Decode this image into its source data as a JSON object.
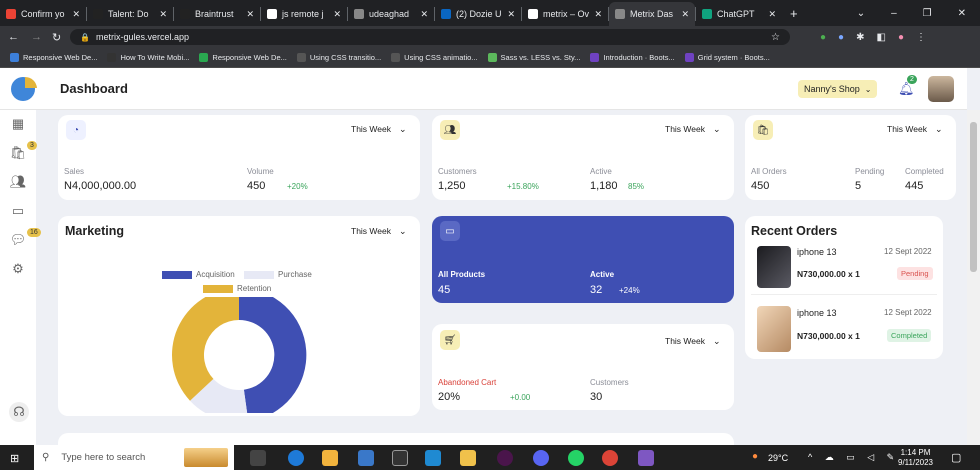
{
  "browser": {
    "tabs": [
      {
        "label": "Confirm yo",
        "color": "#ea4335"
      },
      {
        "label": "Talent: Do",
        "color": "#222"
      },
      {
        "label": "Braintrust",
        "color": "#222"
      },
      {
        "label": "js remote j",
        "color": "#fff"
      },
      {
        "label": "udeaghad",
        "color": "#888"
      },
      {
        "label": "(2) Dozie U",
        "color": "#0a66c2"
      },
      {
        "label": "metrix – Ov",
        "color": "#fff"
      },
      {
        "label": "Metrix Das",
        "color": "#888"
      },
      {
        "label": "ChatGPT",
        "color": "#10a37f"
      }
    ],
    "url": "metrix-gules.vercel.app",
    "bookmarks": [
      "Responsive Web De...",
      "How To Write Mobi...",
      "Responsive Web De...",
      "Using CSS transitio...",
      "Using CSS animatio...",
      "Sass vs. LESS vs. Sty...",
      "Introduction · Boots...",
      "Grid system · Boots..."
    ]
  },
  "header": {
    "title": "Dashboard",
    "shop": "Nanny's Shop",
    "notifications": "2"
  },
  "sidebar": {
    "badges": {
      "orders": "3",
      "messages": "16"
    }
  },
  "sales_card": {
    "period": "This Week",
    "sales_label": "Sales",
    "sales_value": "N4,000,000.00",
    "volume_label": "Volume",
    "volume_value": "450",
    "volume_change": "+20%"
  },
  "customers_card": {
    "period": "This Week",
    "customers_label": "Customers",
    "customers_value": "1,250",
    "customers_change": "+15.80%",
    "active_label": "Active",
    "active_value": "1,180",
    "active_change": "85%"
  },
  "orders_card": {
    "period": "This Week",
    "all_label": "All Orders",
    "all_value": "450",
    "pending_label": "Pending",
    "pending_value": "5",
    "completed_label": "Completed",
    "completed_value": "445"
  },
  "marketing": {
    "title": "Marketing",
    "period": "This Week",
    "legend": [
      "Acquisition",
      "Purchase",
      "Retention"
    ]
  },
  "products_card": {
    "all_label": "All Products",
    "all_value": "45",
    "active_label": "Active",
    "active_value": "32",
    "active_change": "+24%"
  },
  "cart_card": {
    "period": "This Week",
    "abandoned_label": "Abandoned Cart",
    "abandoned_value": "20%",
    "abandoned_change": "+0.00",
    "customers_label": "Customers",
    "customers_value": "30"
  },
  "recent_orders": {
    "title": "Recent Orders",
    "items": [
      {
        "name": "iphone 13",
        "date": "12 Sept 2022",
        "price": "N730,000.00 x 1",
        "status": "Pending"
      },
      {
        "name": "iphone 13",
        "date": "12 Sept 2022",
        "price": "N730,000.00 x 1",
        "status": "Completed"
      }
    ]
  },
  "taskbar": {
    "search_placeholder": "Type here to search",
    "weather": "29°C",
    "time": "1:14 PM",
    "date": "9/11/2023"
  },
  "colors": {
    "blue": "#3f4fb3",
    "yellow": "#e3b43a",
    "light": "#e7e9f5"
  }
}
